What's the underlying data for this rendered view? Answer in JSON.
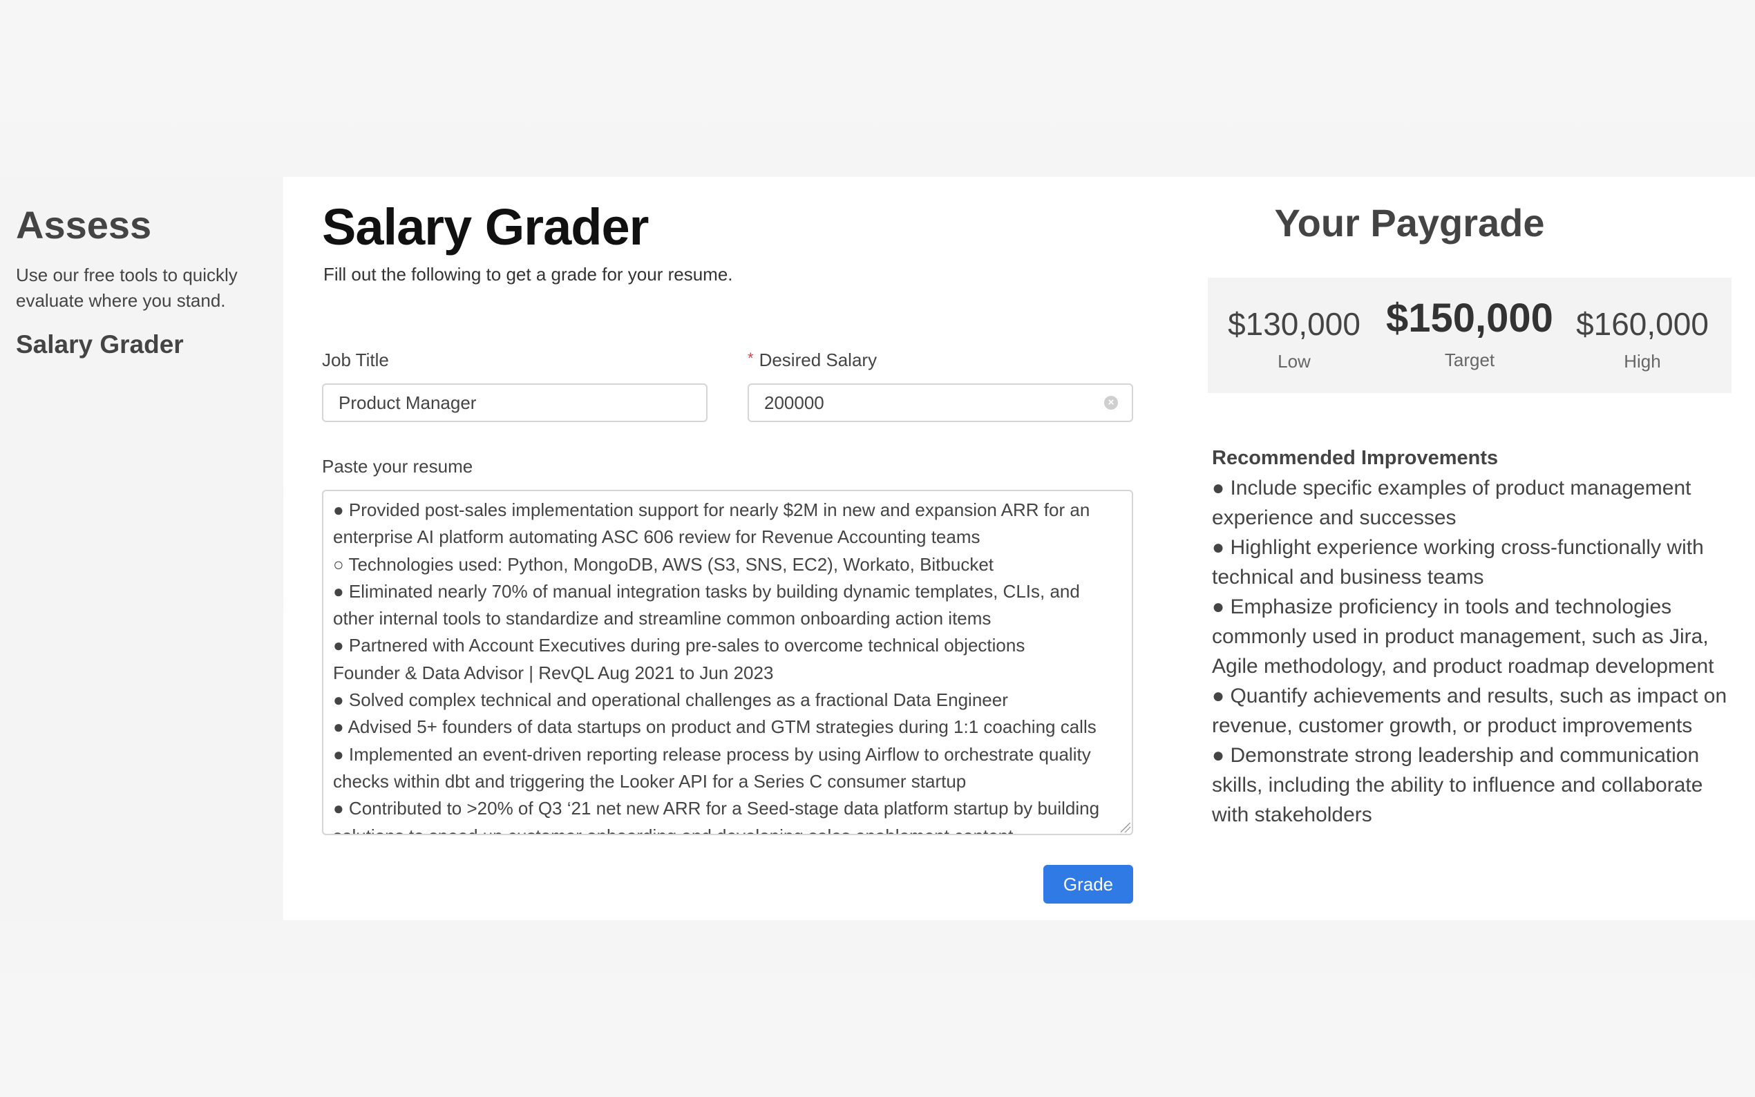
{
  "sidebar": {
    "title": "Assess",
    "description": "Use our free tools to quickly evaluate where you stand.",
    "link_label": "Salary Grader"
  },
  "main": {
    "title": "Salary Grader",
    "subtitle": "Fill out the following to get a grade for your resume.",
    "job_title": {
      "label": "Job Title",
      "value": "Product Manager"
    },
    "desired_salary": {
      "required_mark": "*",
      "label": "Desired Salary",
      "value": "200000"
    },
    "resume": {
      "label": "Paste your resume",
      "lines": [
        "● Provided post-sales implementation support for nearly $2M in new and expansion ARR for an",
        "enterprise AI platform automating ASC 606 review for Revenue Accounting teams",
        "○ Technologies used: Python, MongoDB, AWS (S3, SNS, EC2), Workato, Bitbucket",
        "● Eliminated nearly 70% of manual integration tasks by building dynamic templates, CLIs, and",
        "other internal tools to standardize and streamline common onboarding action items",
        "● Partnered with Account Executives during pre-sales to overcome technical objections",
        "Founder & Data Advisor | RevQL Aug 2021 to Jun 2023",
        "● Solved complex technical and operational challenges as a fractional Data Engineer",
        "● Advised 5+ founders of data startups on product and GTM strategies during 1:1 coaching calls",
        "● Implemented an event-driven reporting release process by using Airflow to orchestrate quality",
        "checks within dbt and triggering the Looker API for a Series C consumer startup",
        "● Contributed to >20% of Q3 ‘21 net new ARR for a Seed-stage data platform startup by building",
        "solutions to speed up customer onboarding and developing sales enablement content"
      ]
    },
    "grade_button_label": "Grade"
  },
  "paygrade": {
    "title": "Your Paygrade",
    "low": {
      "amount": "$130,000",
      "label": "Low"
    },
    "target": {
      "amount": "$150,000",
      "label": "Target"
    },
    "high": {
      "amount": "$160,000",
      "label": "High"
    },
    "improvements_heading": "Recommended Improvements",
    "improvements": [
      "● Include specific examples of product management experience and successes",
      "● Highlight experience working cross-functionally with technical and business teams",
      "● Emphasize proficiency in tools and technologies commonly used in product management, such as Jira, Agile methodology, and product roadmap development",
      "● Quantify achievements and results, such as impact on revenue, customer growth, or product improvements",
      "● Demonstrate strong leadership and communication skills, including the ability to influence and collaborate with stakeholders"
    ]
  },
  "colors": {
    "accent": "#2f7ae5",
    "required": "#e53e3e",
    "panel_bg": "#ffffff",
    "page_bg": "#f4f4f4"
  }
}
